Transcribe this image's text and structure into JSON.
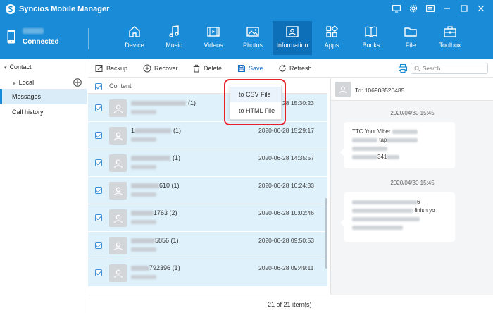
{
  "app": {
    "title": "Syncios Mobile Manager"
  },
  "device": {
    "status": "Connected"
  },
  "nav": [
    {
      "label": "Device",
      "icon": "home-icon"
    },
    {
      "label": "Music",
      "icon": "music-note-icon"
    },
    {
      "label": "Videos",
      "icon": "film-icon"
    },
    {
      "label": "Photos",
      "icon": "image-icon"
    },
    {
      "label": "Information",
      "icon": "contact-card-icon",
      "active": true
    },
    {
      "label": "Apps",
      "icon": "apps-grid-icon"
    },
    {
      "label": "Books",
      "icon": "book-icon"
    },
    {
      "label": "File",
      "icon": "folder-icon"
    },
    {
      "label": "Toolbox",
      "icon": "toolbox-icon"
    }
  ],
  "sidebar": {
    "contact": "Contact",
    "local": "Local",
    "messages": "Messages",
    "call_history": "Call history"
  },
  "toolbar": {
    "backup": "Backup",
    "recover": "Recover",
    "delete": "Delete",
    "save": "Save",
    "refresh": "Refresh",
    "search_placeholder": "Search"
  },
  "list": {
    "header": "Content",
    "rows": [
      {
        "number_suffix": "",
        "count": "(1)",
        "date": "2020-06-28 15:30:23"
      },
      {
        "number_prefix": "1",
        "number_suffix": "",
        "count": "(1)",
        "date": "2020-06-28 15:29:17"
      },
      {
        "number_suffix": "",
        "count": "(1)",
        "date": "2020-06-28 14:35:57"
      },
      {
        "number_suffix": "610",
        "count": "(1)",
        "date": "2020-06-28 10:24:33"
      },
      {
        "number_suffix": "1763",
        "count": "(2)",
        "date": "2020-06-28 10:02:46"
      },
      {
        "number_suffix": "5856",
        "count": "(1)",
        "date": "2020-06-28 09:50:53"
      },
      {
        "number_suffix": "792396",
        "count": "(1)",
        "date": "2020-06-28 09:49:11"
      }
    ]
  },
  "save_menu": {
    "csv": "to CSV File",
    "html": "to HTML File"
  },
  "detail": {
    "to": "To: 106908520485",
    "messages": [
      {
        "time": "2020/04/30 15:45",
        "line1": "TTC Your Viber",
        "line2_mid": "tap",
        "line4_mid": "341"
      },
      {
        "time": "2020/04/30 15:45",
        "line1_end": "6",
        "line2_end": "finish yo"
      }
    ]
  },
  "status": {
    "count": "21 of 21 item(s)"
  },
  "colors": {
    "brand": "#1a8bd6",
    "active_nav": "#0c6fb8",
    "row_selected": "#dff1fb",
    "highlight": "#e8202a"
  }
}
